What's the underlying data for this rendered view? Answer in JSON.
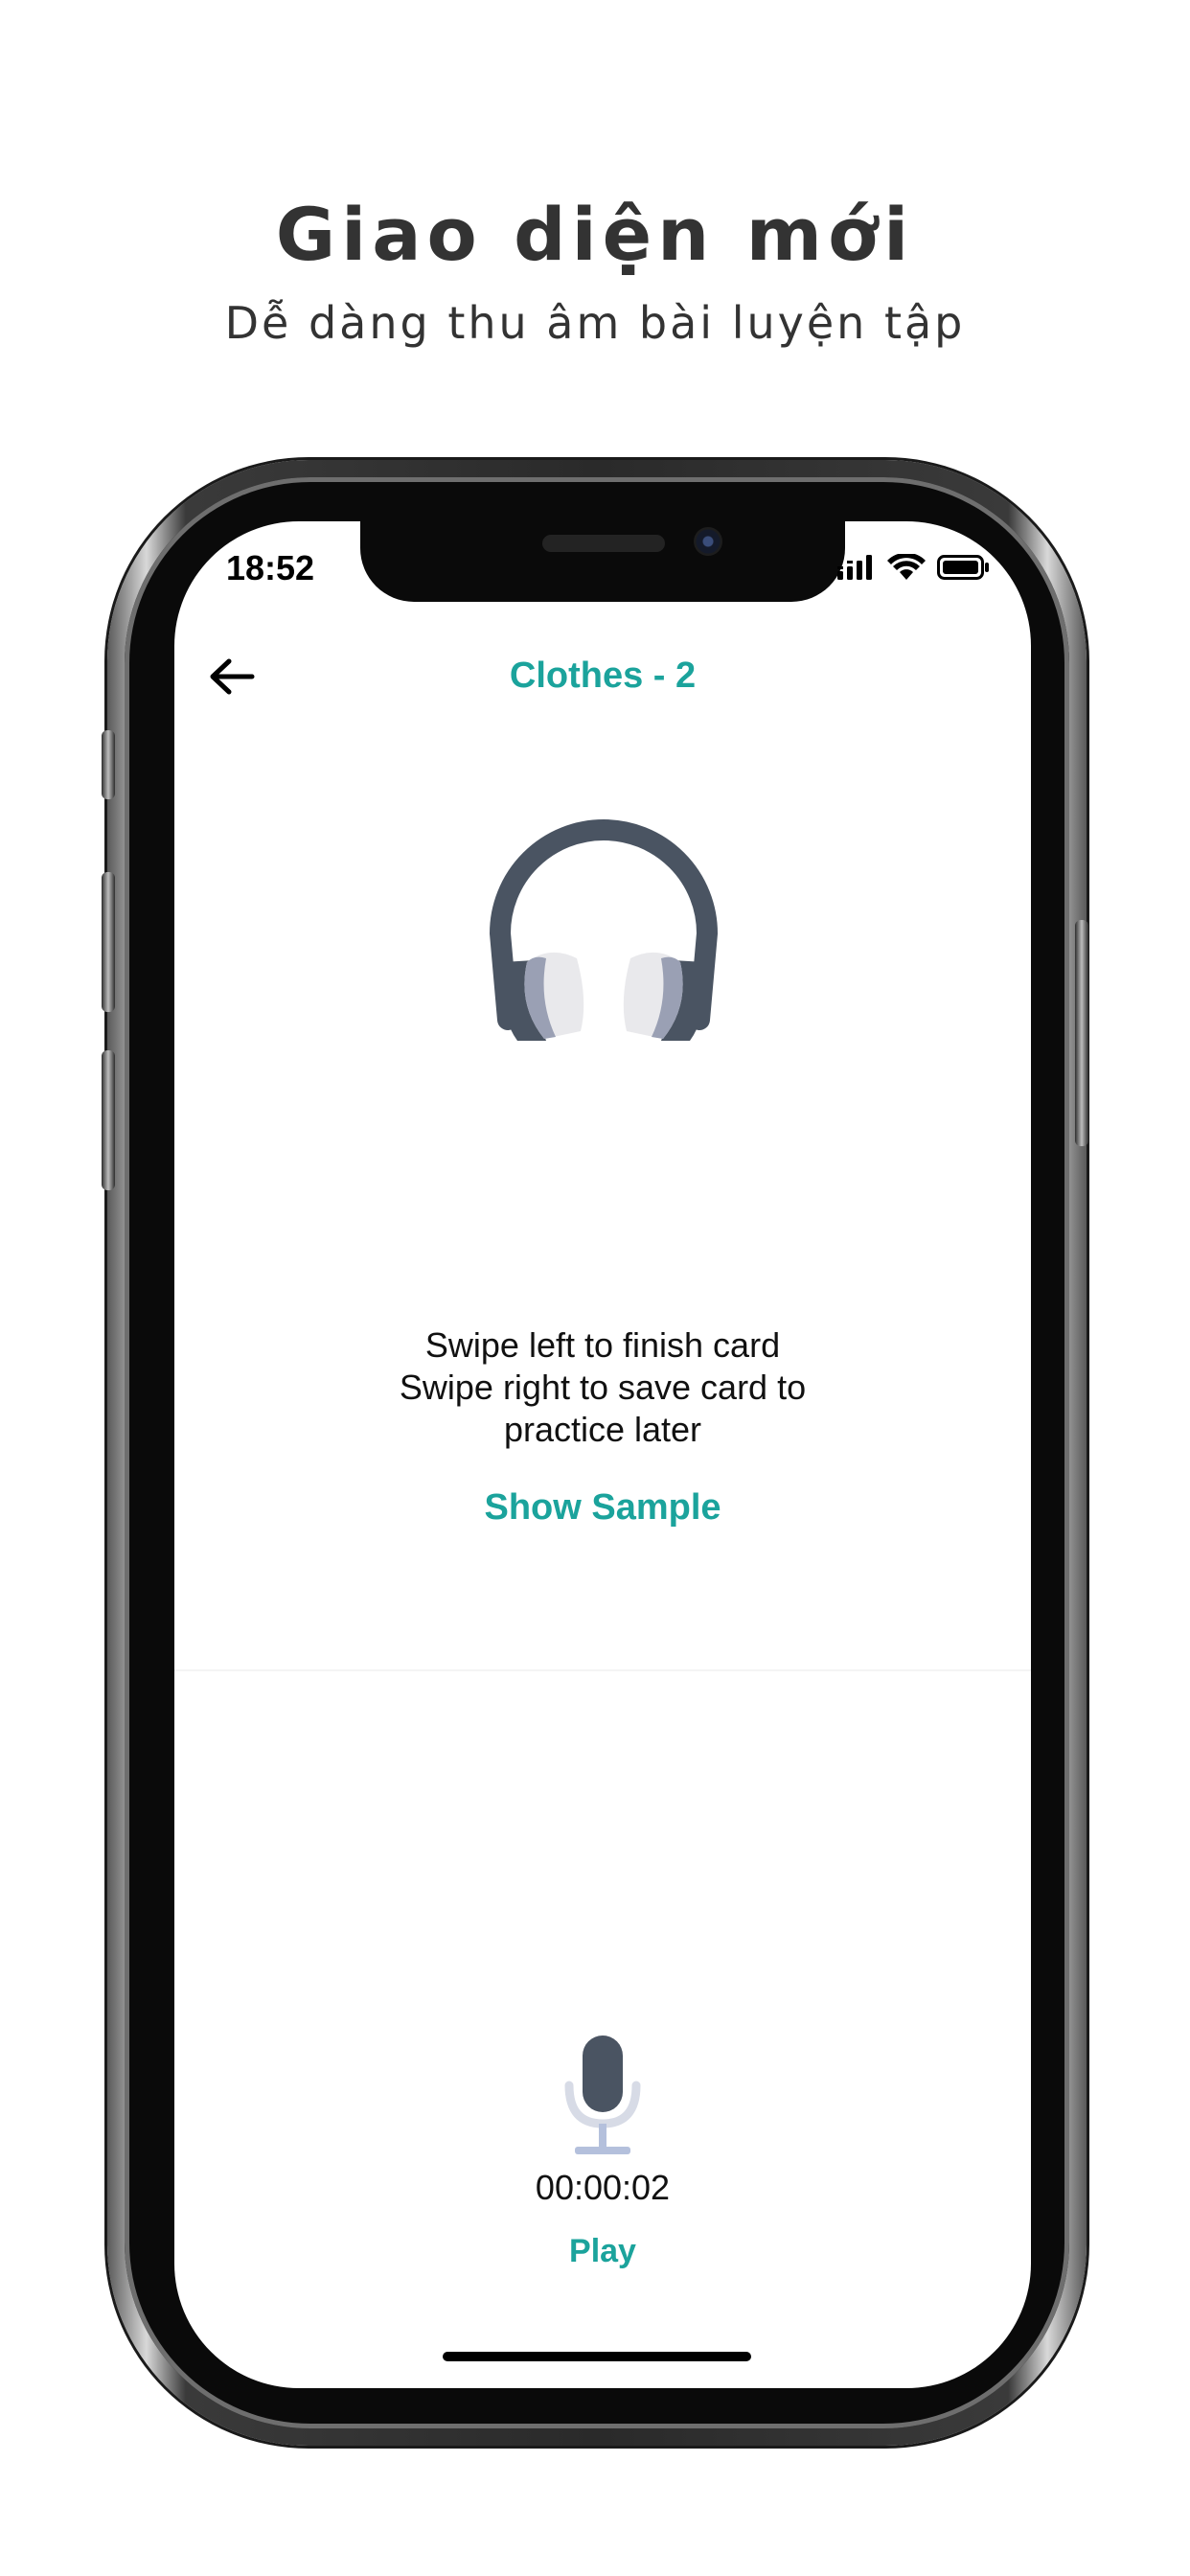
{
  "promo": {
    "title": "Giao diện mới",
    "subtitle": "Dễ dàng thu âm bài luyện tập"
  },
  "status_bar": {
    "time": "18:52",
    "icons": [
      "signal-icon",
      "wifi-icon",
      "battery-icon"
    ]
  },
  "nav": {
    "back_icon": "arrow-left-icon",
    "title": "Clothes - 2"
  },
  "card": {
    "icon": "headphones-icon",
    "instructions": [
      "Swipe left to finish card",
      "Swipe right to save card to",
      "practice later"
    ],
    "show_sample_label": "Show Sample"
  },
  "recorder": {
    "icon": "microphone-icon",
    "timer": "00:00:02",
    "play_label": "Play"
  },
  "colors": {
    "accent": "#1ba39c",
    "icon_dark": "#4a5462",
    "text": "#111111"
  }
}
